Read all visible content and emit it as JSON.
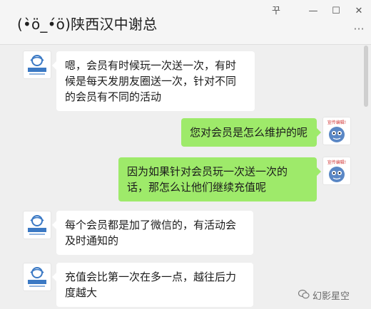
{
  "window": {
    "title": "(•̀ö_•́ö)陕西汉中谢总",
    "controls": {
      "pin": "꾸",
      "minimize": "—",
      "maximize": "☐",
      "close": "✕",
      "more": "···"
    }
  },
  "messages": [
    {
      "side": "left",
      "text": "嗯，会员有时候玩一次送一次，有时候是每天发朋友圈送一次，针对不同的会员有不同的活动",
      "avatar_icon": "brand-logo-icon"
    },
    {
      "side": "right",
      "text": "您对会员是怎么维护的呢",
      "avatar_icon": "cartoon-mascot-icon"
    },
    {
      "side": "right",
      "text": "因为如果针对会员玩一次送一次的话，那怎么让他们继续充值呢",
      "avatar_icon": "cartoon-mascot-icon"
    },
    {
      "side": "left",
      "text": "每个会员都是加了微信的，有活动会及时通知的",
      "avatar_icon": "brand-logo-icon"
    },
    {
      "side": "left",
      "text": "充值会比第一次在多一点，越往后力度越大",
      "avatar_icon": "brand-logo-icon"
    }
  ],
  "avatar_badge": "宣传编辑!",
  "brand_logo_text": "幻影星空",
  "watermark": {
    "text": "幻影星空",
    "icon": "wechat-icon"
  },
  "colors": {
    "incoming_bubble": "#ffffff",
    "outgoing_bubble": "#9eea6a",
    "background": "#efefef"
  }
}
